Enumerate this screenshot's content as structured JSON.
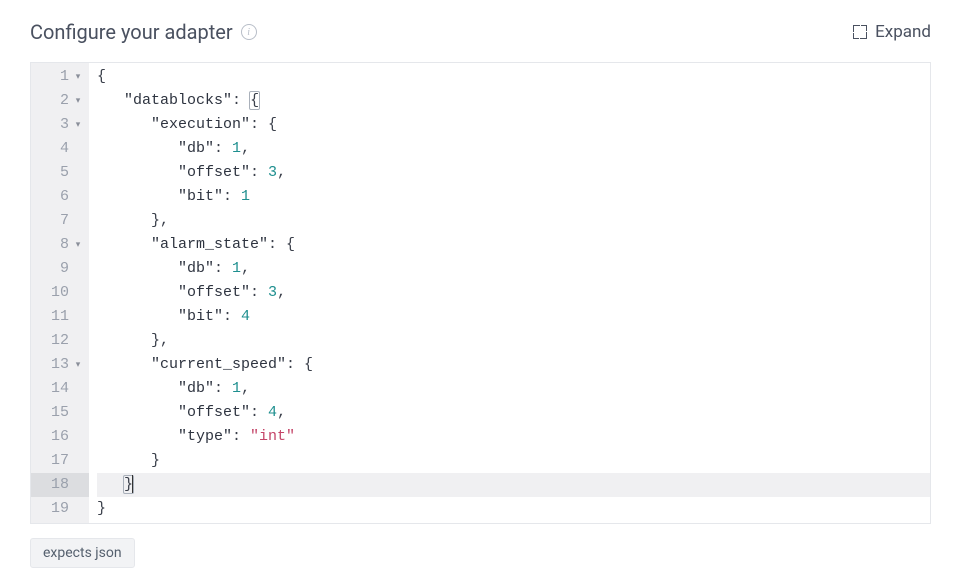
{
  "header": {
    "title": "Configure your adapter",
    "info_tooltip": "i",
    "expand_label": "Expand"
  },
  "editor": {
    "active_line": 18,
    "lines": [
      {
        "n": 1,
        "fold": true,
        "indent": 0,
        "tokens": [
          {
            "t": "{",
            "c": "punct"
          }
        ]
      },
      {
        "n": 2,
        "fold": true,
        "indent": 1,
        "tokens": [
          {
            "t": "\"datablocks\"",
            "c": "key"
          },
          {
            "t": ": ",
            "c": "punct"
          },
          {
            "t": "{",
            "c": "punct",
            "hl": true
          }
        ]
      },
      {
        "n": 3,
        "fold": true,
        "indent": 2,
        "tokens": [
          {
            "t": "\"execution\"",
            "c": "key"
          },
          {
            "t": ": {",
            "c": "punct"
          }
        ]
      },
      {
        "n": 4,
        "fold": false,
        "indent": 3,
        "tokens": [
          {
            "t": "\"db\"",
            "c": "key"
          },
          {
            "t": ": ",
            "c": "punct"
          },
          {
            "t": "1",
            "c": "num"
          },
          {
            "t": ",",
            "c": "punct"
          }
        ]
      },
      {
        "n": 5,
        "fold": false,
        "indent": 3,
        "tokens": [
          {
            "t": "\"offset\"",
            "c": "key"
          },
          {
            "t": ": ",
            "c": "punct"
          },
          {
            "t": "3",
            "c": "num"
          },
          {
            "t": ",",
            "c": "punct"
          }
        ]
      },
      {
        "n": 6,
        "fold": false,
        "indent": 3,
        "tokens": [
          {
            "t": "\"bit\"",
            "c": "key"
          },
          {
            "t": ": ",
            "c": "punct"
          },
          {
            "t": "1",
            "c": "num"
          }
        ]
      },
      {
        "n": 7,
        "fold": false,
        "indent": 2,
        "tokens": [
          {
            "t": "},",
            "c": "punct"
          }
        ]
      },
      {
        "n": 8,
        "fold": true,
        "indent": 2,
        "tokens": [
          {
            "t": "\"alarm_state\"",
            "c": "key"
          },
          {
            "t": ": {",
            "c": "punct"
          }
        ]
      },
      {
        "n": 9,
        "fold": false,
        "indent": 3,
        "tokens": [
          {
            "t": "\"db\"",
            "c": "key"
          },
          {
            "t": ": ",
            "c": "punct"
          },
          {
            "t": "1",
            "c": "num"
          },
          {
            "t": ",",
            "c": "punct"
          }
        ]
      },
      {
        "n": 10,
        "fold": false,
        "indent": 3,
        "tokens": [
          {
            "t": "\"offset\"",
            "c": "key"
          },
          {
            "t": ": ",
            "c": "punct"
          },
          {
            "t": "3",
            "c": "num"
          },
          {
            "t": ",",
            "c": "punct"
          }
        ]
      },
      {
        "n": 11,
        "fold": false,
        "indent": 3,
        "tokens": [
          {
            "t": "\"bit\"",
            "c": "key"
          },
          {
            "t": ": ",
            "c": "punct"
          },
          {
            "t": "4",
            "c": "num"
          }
        ]
      },
      {
        "n": 12,
        "fold": false,
        "indent": 2,
        "tokens": [
          {
            "t": "},",
            "c": "punct"
          }
        ]
      },
      {
        "n": 13,
        "fold": true,
        "indent": 2,
        "tokens": [
          {
            "t": "\"current_speed\"",
            "c": "key"
          },
          {
            "t": ": {",
            "c": "punct"
          }
        ]
      },
      {
        "n": 14,
        "fold": false,
        "indent": 3,
        "tokens": [
          {
            "t": "\"db\"",
            "c": "key"
          },
          {
            "t": ": ",
            "c": "punct"
          },
          {
            "t": "1",
            "c": "num"
          },
          {
            "t": ",",
            "c": "punct"
          }
        ]
      },
      {
        "n": 15,
        "fold": false,
        "indent": 3,
        "tokens": [
          {
            "t": "\"offset\"",
            "c": "key"
          },
          {
            "t": ": ",
            "c": "punct"
          },
          {
            "t": "4",
            "c": "num"
          },
          {
            "t": ",",
            "c": "punct"
          }
        ]
      },
      {
        "n": 16,
        "fold": false,
        "indent": 3,
        "tokens": [
          {
            "t": "\"type\"",
            "c": "key"
          },
          {
            "t": ": ",
            "c": "punct"
          },
          {
            "t": "\"int\"",
            "c": "str"
          }
        ]
      },
      {
        "n": 17,
        "fold": false,
        "indent": 2,
        "tokens": [
          {
            "t": "}",
            "c": "punct"
          }
        ]
      },
      {
        "n": 18,
        "fold": false,
        "indent": 1,
        "tokens": [
          {
            "t": "}",
            "c": "punct",
            "hl": true
          }
        ],
        "cursor": true
      },
      {
        "n": 19,
        "fold": false,
        "indent": 0,
        "tokens": [
          {
            "t": "}",
            "c": "punct"
          }
        ]
      }
    ]
  },
  "footer": {
    "badge": "expects json"
  }
}
